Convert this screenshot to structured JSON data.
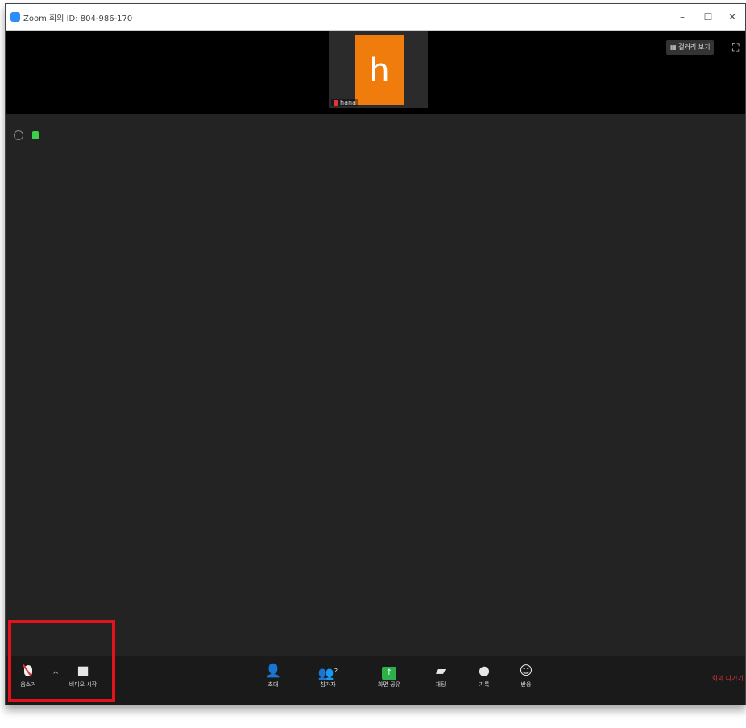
{
  "window": {
    "title": "Zoom 회의 ID: 804-986-170",
    "controls": {
      "minimize": "–",
      "maximize": "☐",
      "close": "✕"
    }
  },
  "thumbnail": {
    "initial": "h",
    "name": "hana"
  },
  "top_right": {
    "speaker_view_label": "갤러리 보기"
  },
  "toolbar": {
    "mute_label": "음소거",
    "video_label": "비디오 시작",
    "invite_label": "초대",
    "participants_label": "참가자",
    "participants_count": "2",
    "share_label": "화면 공유",
    "chat_label": "채팅",
    "record_label": "기록",
    "reactions_label": "반응",
    "end_label": "회의 나가기"
  },
  "colors": {
    "avatar": "#f07c0d",
    "share": "#2bb148",
    "highlight": "#e3131b",
    "lock": "#3ecf4a"
  },
  "icons": [
    "zoom-app-icon",
    "info-icon",
    "lock-icon",
    "mic-muted-icon",
    "video-off-icon",
    "invite-icon",
    "participants-icon",
    "share-screen-icon",
    "chat-icon",
    "record-icon",
    "reactions-icon",
    "fullscreen-icon",
    "gallery-view-icon"
  ]
}
